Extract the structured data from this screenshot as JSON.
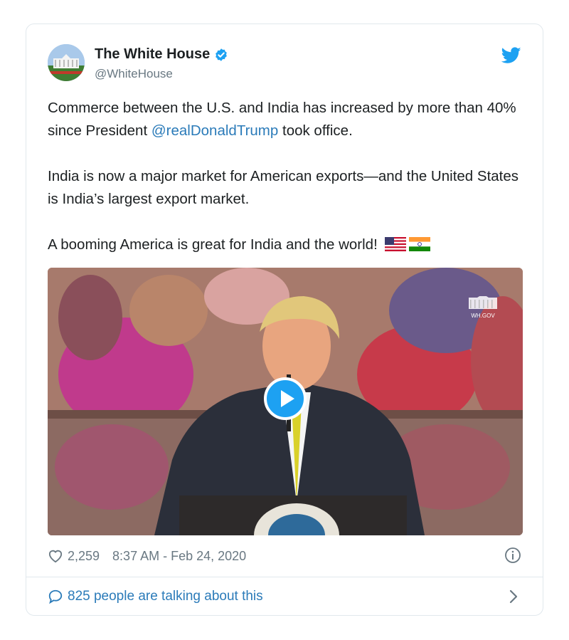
{
  "tweet": {
    "author": {
      "display_name": "The White House",
      "handle": "@WhiteHouse",
      "verified": true,
      "avatar_icon": "white-house-avatar"
    },
    "text": {
      "p1_before": "Commerce between the U.S. and India has increased by more than 40% since President ",
      "p1_mention": "@realDonaldTrump",
      "p1_after": " took office.",
      "p2": "India is now a major market for American exports—and the United States is India’s largest export market.",
      "p3": "A booming America is great for India and the world!",
      "emoji": [
        "us-flag-icon",
        "india-flag-icon"
      ]
    },
    "media": {
      "type": "video",
      "watermark": "WH.GOV",
      "play_icon": "play-icon"
    },
    "likes": "2,259",
    "timestamp": "8:37 AM - Feb 24, 2020",
    "talking": "825 people are talking about this"
  },
  "colors": {
    "accent": "#1da1f2",
    "link": "#2b7bb9",
    "muted": "#697882",
    "border": "#e1e8ed"
  }
}
